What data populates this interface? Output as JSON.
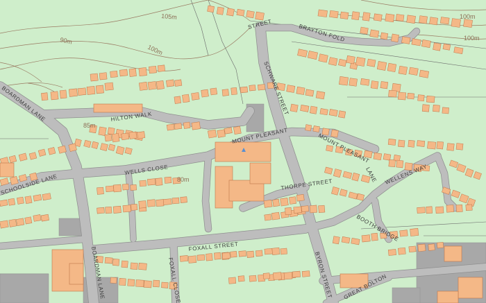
{
  "map": {
    "colors": {
      "land": "#cfeecb",
      "road": "#bdbdbd",
      "road_edge": "#8f8f8f",
      "building": "#f4b887",
      "building_edge": "#c0764a",
      "contour": "#9a7a62",
      "boundary": "#6a6a6a",
      "hardstanding": "#a8a8a8"
    },
    "contour_labels": [
      "105m",
      "100m",
      "90m",
      "100m",
      "100m",
      "85m",
      "80m"
    ],
    "street_labels": [
      "HILTON WALK",
      "BOARDMAN LANE",
      "SCHOOLSIDE LANE",
      "WELLS CLOSE",
      "MOUNT PLEASANT",
      "MOUNT PLEASANT",
      "SCHWARE STREET",
      "BRAYTON FOLD",
      "THORPE STREET",
      "FOXALL STREET",
      "BOARDMAN LANE",
      "FOXALL CLOSE",
      "BYRON STREET",
      "BOOTH BRIDGE",
      "WELLENS WAY",
      "GREAT BOLTON",
      "STREET",
      "LANE"
    ]
  }
}
